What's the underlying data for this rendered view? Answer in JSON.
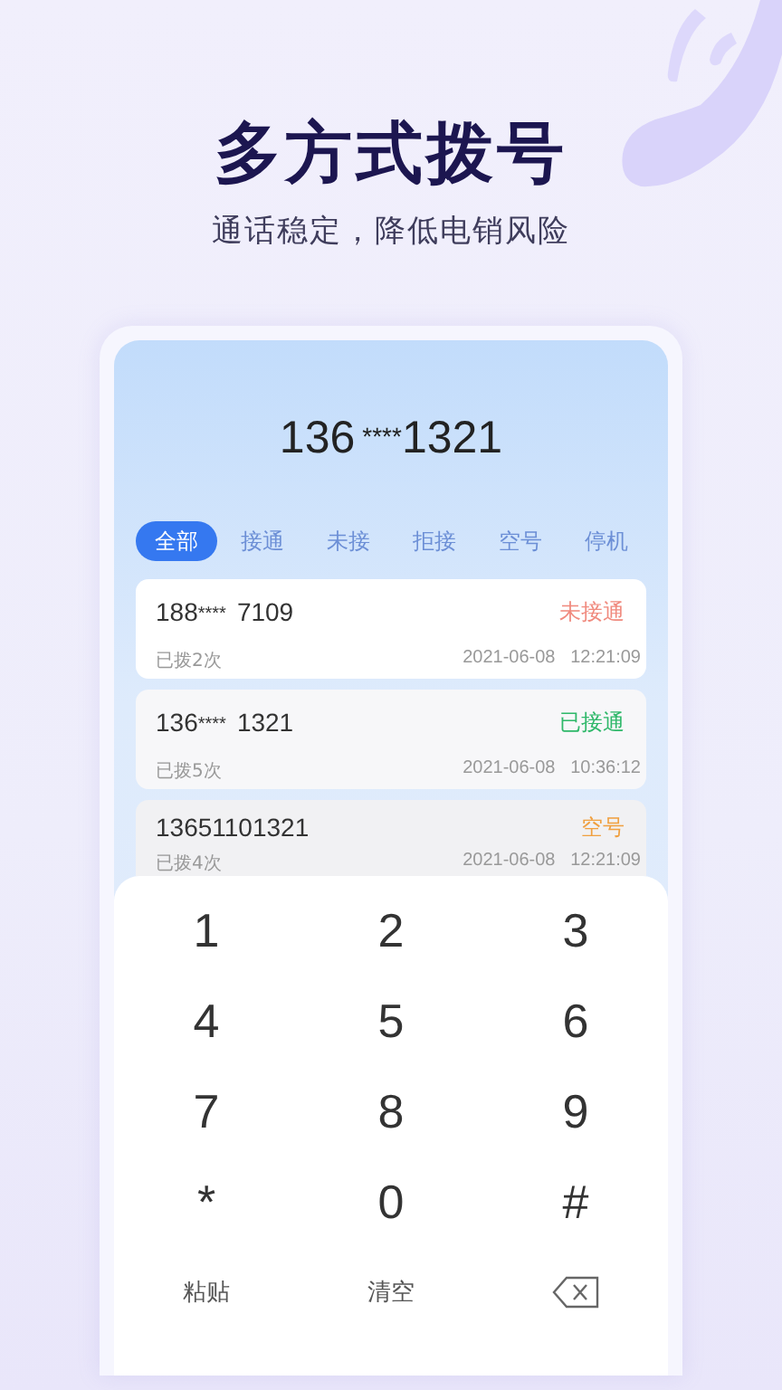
{
  "header": {
    "title": "多方式拨号",
    "subtitle": "通话稳定，降低电销风险"
  },
  "dialer": {
    "number": {
      "head": "136",
      "mask": "****",
      "tail": "1321"
    },
    "tabs": [
      {
        "label": "全部",
        "selected": true
      },
      {
        "label": "接通",
        "selected": false
      },
      {
        "label": "未接",
        "selected": false
      },
      {
        "label": "拒接",
        "selected": false
      },
      {
        "label": "空号",
        "selected": false
      },
      {
        "label": "停机",
        "selected": false
      }
    ],
    "calls": [
      {
        "head": "188",
        "mask": "****",
        "tail": "7109",
        "status": "未接通",
        "color": "#f08a7e",
        "count": "已拨2次",
        "time": "2021-06-08   12:21:09"
      },
      {
        "head": "136",
        "mask": "****",
        "tail": "1321",
        "status": "已接通",
        "color": "#2fb86a",
        "count": "已拨5次",
        "time": "2021-06-08   10:36:12"
      },
      {
        "head": "13651101321",
        "status": "空号",
        "color": "#f0a040",
        "count": "已拨4次",
        "time": "2021-06-08   12:21:09"
      }
    ],
    "keys": [
      {
        "kind": "digit",
        "label": "1"
      },
      {
        "kind": "digit",
        "label": "2"
      },
      {
        "kind": "digit",
        "label": "3"
      },
      {
        "kind": "digit",
        "label": "4"
      },
      {
        "kind": "digit",
        "label": "5"
      },
      {
        "kind": "digit",
        "label": "6"
      },
      {
        "kind": "digit",
        "label": "7"
      },
      {
        "kind": "digit",
        "label": "8"
      },
      {
        "kind": "digit",
        "label": "9"
      },
      {
        "kind": "digit",
        "label": "*"
      },
      {
        "kind": "digit",
        "label": "0"
      },
      {
        "kind": "digit",
        "label": "#"
      },
      {
        "kind": "text",
        "label": "粘贴"
      },
      {
        "kind": "text",
        "label": "清空"
      },
      {
        "kind": "backspace"
      }
    ]
  }
}
